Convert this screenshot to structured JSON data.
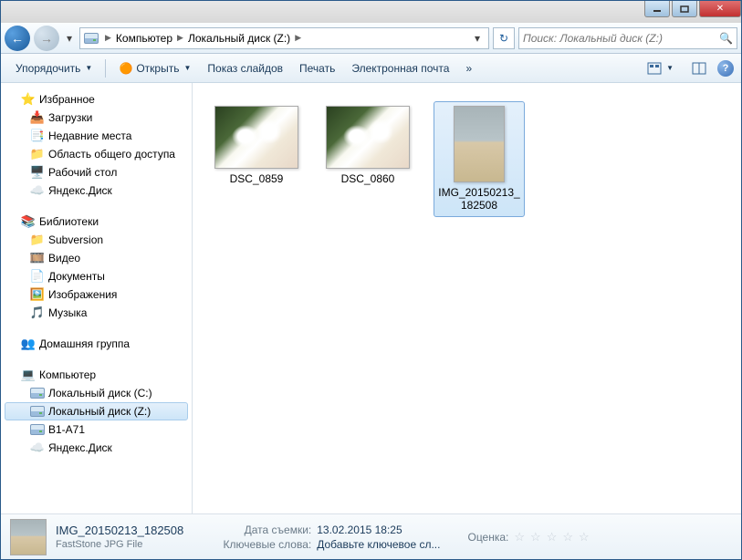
{
  "breadcrumb": {
    "root_icon": "computer",
    "items": [
      "Компьютер",
      "Локальный диск (Z:)"
    ]
  },
  "search": {
    "placeholder": "Поиск: Локальный диск (Z:)"
  },
  "toolbar": {
    "organize": "Упорядочить",
    "open": "Открыть",
    "slideshow": "Показ слайдов",
    "print": "Печать",
    "email": "Электронная почта",
    "overflow": "»"
  },
  "sidebar": {
    "favorites": {
      "label": "Избранное",
      "items": [
        {
          "icon": "download",
          "label": "Загрузки"
        },
        {
          "icon": "recent",
          "label": "Недавние места"
        },
        {
          "icon": "share",
          "label": "Область общего доступа"
        },
        {
          "icon": "desktop",
          "label": "Рабочий стол"
        },
        {
          "icon": "cloud",
          "label": "Яндекс.Диск"
        }
      ]
    },
    "libraries": {
      "label": "Библиотеки",
      "items": [
        {
          "icon": "folder",
          "label": "Subversion"
        },
        {
          "icon": "video",
          "label": "Видео"
        },
        {
          "icon": "doc",
          "label": "Документы"
        },
        {
          "icon": "img",
          "label": "Изображения"
        },
        {
          "icon": "music",
          "label": "Музыка"
        }
      ]
    },
    "homegroup": {
      "label": "Домашняя группа"
    },
    "computer": {
      "label": "Компьютер",
      "items": [
        {
          "icon": "drive",
          "label": "Локальный диск (C:)"
        },
        {
          "icon": "drive",
          "label": "Локальный диск (Z:)",
          "selected": true
        },
        {
          "icon": "usb",
          "label": "B1-A71"
        },
        {
          "icon": "cloud",
          "label": "Яндекс.Диск"
        }
      ]
    }
  },
  "files": [
    {
      "name": "DSC_0859",
      "thumb": "flower",
      "orient": "landscape"
    },
    {
      "name": "DSC_0860",
      "thumb": "flower",
      "orient": "landscape"
    },
    {
      "name": "IMG_20150213_182508",
      "thumb": "room",
      "orient": "portrait",
      "selected": true
    }
  ],
  "details": {
    "name": "IMG_20150213_182508",
    "type": "FastStone JPG File",
    "date_label": "Дата съемки:",
    "date_value": "13.02.2015 18:25",
    "keywords_label": "Ключевые слова:",
    "keywords_value": "Добавьте ключевое сл...",
    "rating_label": "Оценка:"
  }
}
